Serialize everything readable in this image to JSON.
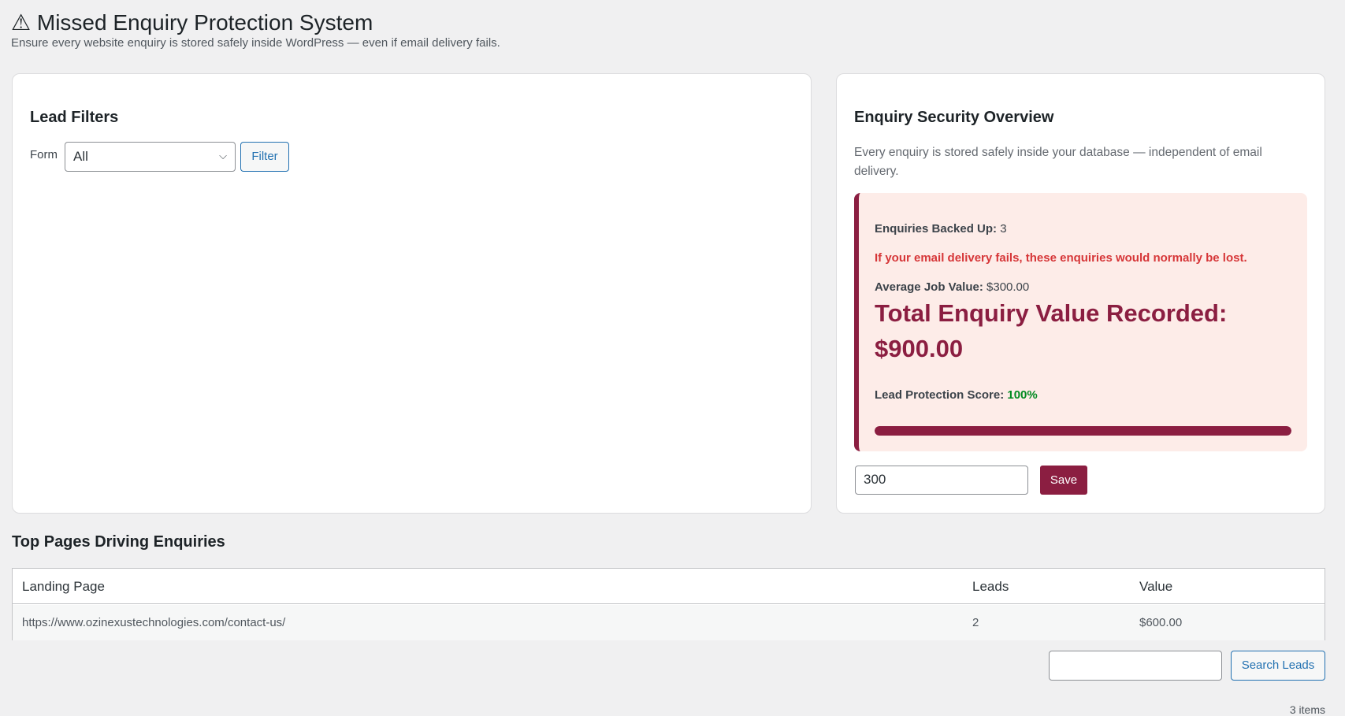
{
  "header": {
    "title": "⚠ Missed Enquiry Protection System",
    "subtitle": "Ensure every website enquiry is stored safely inside WordPress — even if email delivery fails."
  },
  "filters": {
    "title": "Lead Filters",
    "form_label": "Form",
    "form_value": "All",
    "filter_label": "Filter"
  },
  "overview": {
    "title": "Enquiry Security Overview",
    "description": "Every enquiry is stored safely inside your database — independent of email delivery.",
    "backed_up_label": "Enquiries Backed Up:",
    "backed_up_value": "3",
    "warning": "If your email delivery fails, these enquiries would normally be lost.",
    "avg_label": "Average Job Value:",
    "avg_value": "$300.00",
    "total_label": "Total Enquiry Value Recorded:",
    "total_value": "$900.00",
    "score_label": "Lead Protection Score:",
    "score_value": "100%",
    "score_percent": 100,
    "avg_input_value": "300",
    "save_label": "Save",
    "accent": "#8b1e41"
  },
  "top_pages": {
    "title": "Top Pages Driving Enquiries",
    "columns": [
      "Landing Page",
      "Leads",
      "Value"
    ],
    "rows": [
      [
        "https://www.ozinexustechnologies.com/contact-us/",
        "2",
        "$600.00"
      ]
    ]
  },
  "search": {
    "button_label": "Search Leads",
    "value": ""
  },
  "items_count": "3 items"
}
